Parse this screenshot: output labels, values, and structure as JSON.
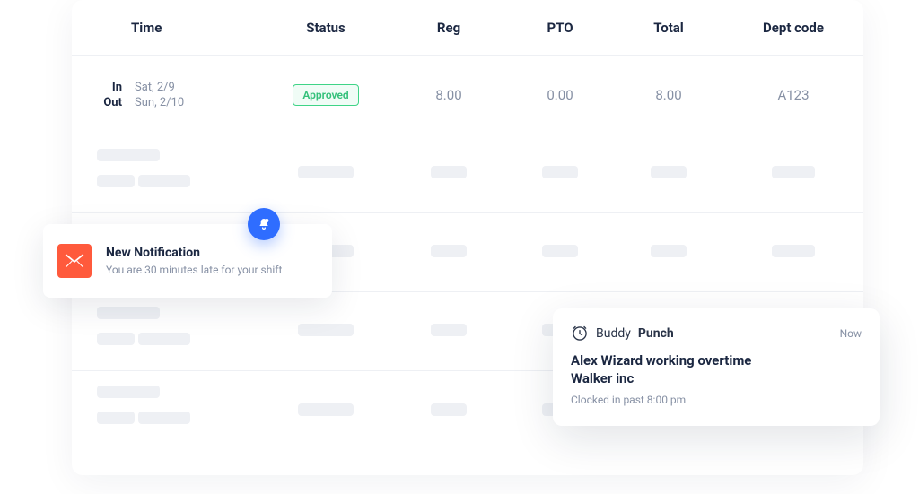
{
  "table": {
    "headers": {
      "time": "Time",
      "status": "Status",
      "reg": "Reg",
      "pto": "PTO",
      "total": "Total",
      "dept": "Dept code"
    },
    "row1": {
      "in_label": "In",
      "in_value": "Sat, 2/9",
      "out_label": "Out",
      "out_value": "Sun, 2/10",
      "status": "Approved",
      "reg": "8.00",
      "pto": "0.00",
      "total": "8.00",
      "dept": "A123"
    }
  },
  "notification": {
    "title": "New Notification",
    "body": "You are 30 minutes late for your shift"
  },
  "toast": {
    "brand_a": "Buddy",
    "brand_b": "Punch",
    "time": "Now",
    "title_line1": "Alex Wizard working overtime",
    "title_line2": "Walker inc",
    "subtitle": "Clocked in past 8:00 pm"
  }
}
